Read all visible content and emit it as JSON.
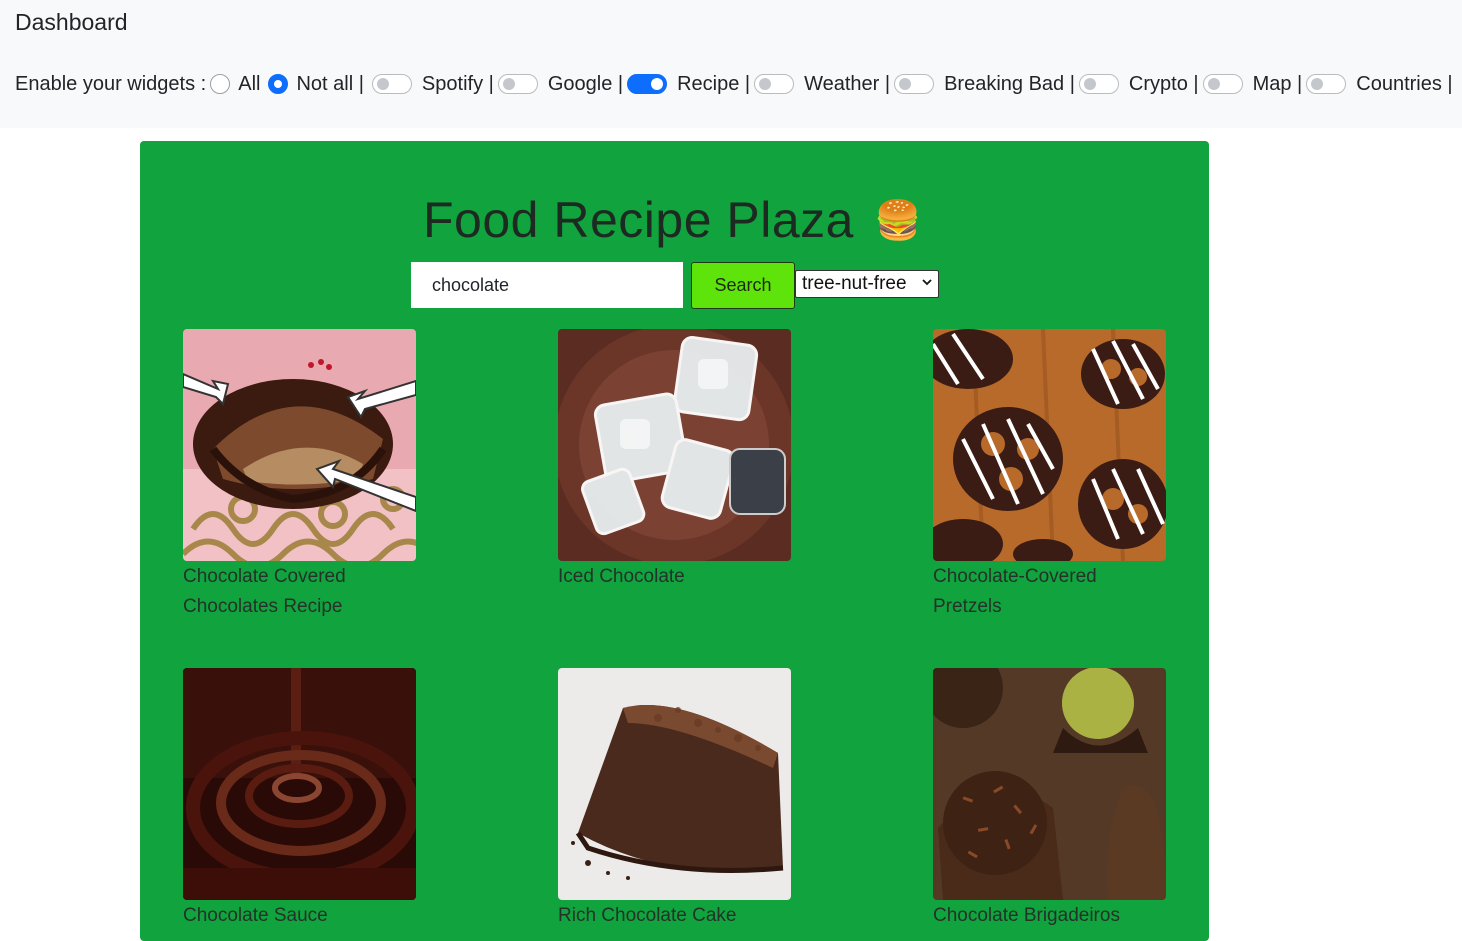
{
  "header": {
    "title": "Dashboard",
    "widgets_label": "Enable your widgets :",
    "radio_all": "All",
    "radio_not_all": "Not all |",
    "selected_radio": "Not all",
    "widgets": [
      {
        "label": "Spotify |",
        "enabled": false
      },
      {
        "label": "Google |",
        "enabled": false
      },
      {
        "label": "Recipe |",
        "enabled": true
      },
      {
        "label": "Weather |",
        "enabled": false
      },
      {
        "label": "Breaking Bad |",
        "enabled": false
      },
      {
        "label": "Crypto |",
        "enabled": false
      },
      {
        "label": "Map |",
        "enabled": false
      },
      {
        "label": "Countries |",
        "enabled": false
      }
    ]
  },
  "recipe_app": {
    "title": "Food Recipe Plaza",
    "title_emoji": "🍔",
    "search_value": "chocolate",
    "search_button": "Search",
    "diet_filter": "tree-nut-free",
    "accent_color": "#10a33e",
    "button_color": "#5ee40a",
    "recipes": [
      {
        "name": "Chocolate Covered Chocolates Recipe"
      },
      {
        "name": "Iced Chocolate"
      },
      {
        "name": "Chocolate-Covered Pretzels"
      },
      {
        "name": "Chocolate Sauce"
      },
      {
        "name": "Rich Chocolate Cake"
      },
      {
        "name": "Chocolate Brigadeiros"
      }
    ]
  }
}
